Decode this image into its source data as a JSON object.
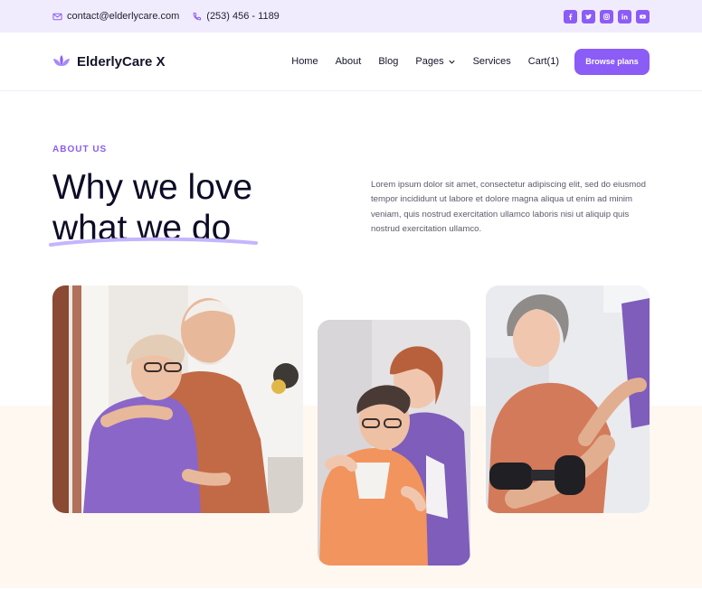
{
  "topbar": {
    "email": "contact@elderlycare.com",
    "phone": "(253) 456 - 1189",
    "socials": [
      "facebook-icon",
      "twitter-icon",
      "instagram-icon",
      "linkedin-icon",
      "youtube-icon"
    ]
  },
  "navbar": {
    "brand": "ElderlyCare X",
    "items": [
      "Home",
      "About",
      "Blog",
      "Pages",
      "Services",
      "Cart(1)"
    ],
    "cta": "Browse plans"
  },
  "hero": {
    "eyebrow": "ABOUT US",
    "headline_line1": "Why we love",
    "headline_line2": "what we do",
    "lead": "Lorem ipsum dolor sit amet, consectetur adipiscing elit, sed do eiusmod tempor incididunt ut labore et dolore magna aliqua ut enim ad minim veniam, quis nostrud exercitation ullamco laboris nisi ut aliquip quis nostrud exercitation ullamco."
  },
  "colors": {
    "accent": "#8b5cf6",
    "topbar_bg": "#f1ecfd",
    "cream_bg": "#fff8f1",
    "heading": "#0d0b26"
  }
}
